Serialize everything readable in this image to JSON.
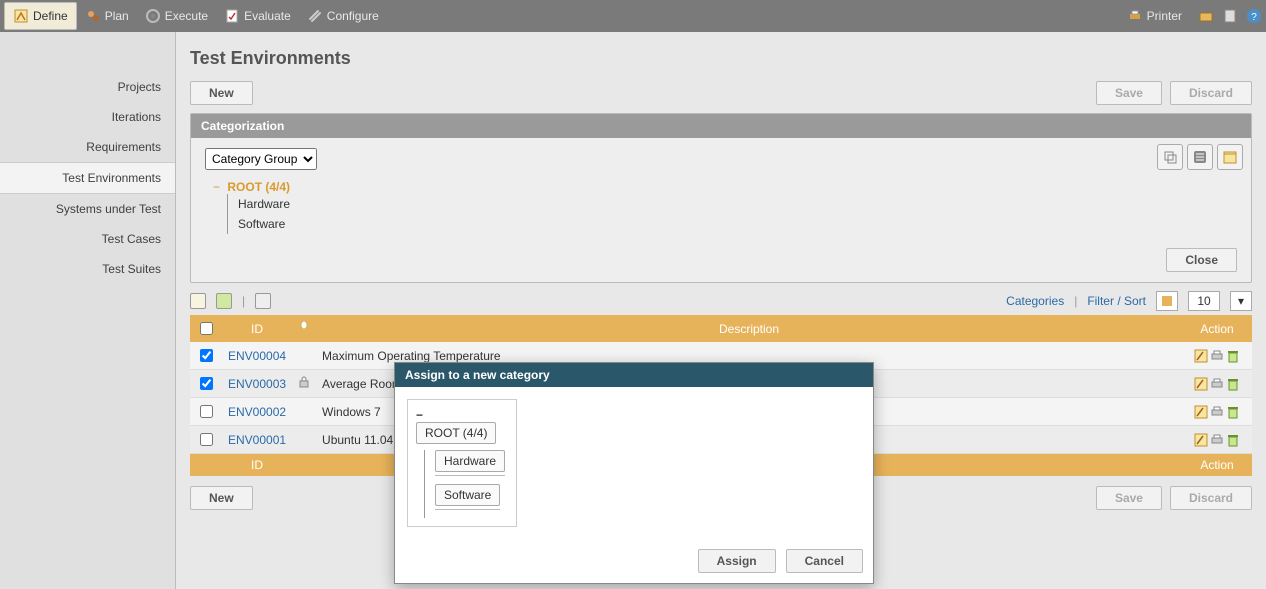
{
  "toolbar": {
    "define": "Define",
    "plan": "Plan",
    "execute": "Execute",
    "evaluate": "Evaluate",
    "configure": "Configure",
    "printer": "Printer"
  },
  "sidebar": {
    "items": [
      "Projects",
      "Iterations",
      "Requirements",
      "Test Environments",
      "Systems under Test",
      "Test Cases",
      "Test Suites"
    ],
    "activeIndex": 3
  },
  "page": {
    "title": "Test Environments",
    "new": "New",
    "save": "Save",
    "discard": "Discard"
  },
  "categorization": {
    "title": "Categorization",
    "groupLabel": "Category Group",
    "tree": {
      "root": "ROOT (4/4)",
      "children": [
        "Hardware",
        "Software"
      ]
    },
    "close": "Close"
  },
  "filter": {
    "categories": "Categories",
    "filterSort": "Filter / Sort",
    "pageSize": "10"
  },
  "grid": {
    "headers": {
      "id": "ID",
      "description": "Description",
      "action": "Action"
    },
    "rows": [
      {
        "checked": true,
        "id": "ENV00004",
        "locked": false,
        "description": "Maximum Operating Temperature"
      },
      {
        "checked": true,
        "id": "ENV00003",
        "locked": true,
        "description": "Average Room Temperature"
      },
      {
        "checked": false,
        "id": "ENV00002",
        "locked": false,
        "description": "Windows 7"
      },
      {
        "checked": false,
        "id": "ENV00001",
        "locked": false,
        "description": "Ubuntu  11.04"
      }
    ]
  },
  "modal": {
    "title": "Assign to a new category",
    "root": "ROOT (4/4)",
    "children": [
      "Hardware",
      "Software"
    ],
    "assign": "Assign",
    "cancel": "Cancel"
  }
}
